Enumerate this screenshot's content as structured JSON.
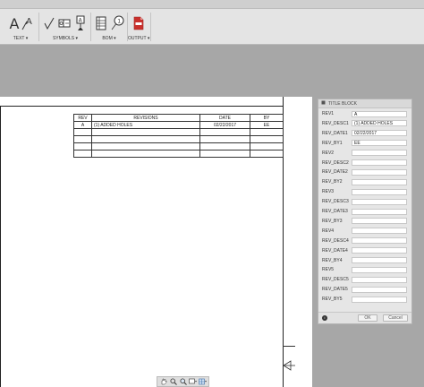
{
  "ribbon": {
    "groups": [
      {
        "label": "TEXT ▾"
      },
      {
        "label": "SYMBOLS ▾"
      },
      {
        "label": "BOM ▾"
      },
      {
        "label": "OUTPUT ▾"
      }
    ]
  },
  "revision_table": {
    "headers": [
      "REV",
      "REVISIONS",
      "DATE",
      "BY"
    ],
    "rows": [
      [
        "A",
        "(1) ADDED HOLES",
        "02/22/2017",
        "EE"
      ],
      [
        "",
        "",
        "",
        ""
      ],
      [
        "",
        "",
        "",
        ""
      ],
      [
        "",
        "",
        "",
        ""
      ],
      [
        "",
        "",
        "",
        ""
      ]
    ]
  },
  "panel": {
    "title": "TITLE BLOCK",
    "fields": [
      {
        "label": "REV1",
        "value": "A"
      },
      {
        "label": "REV_DESC1",
        "value": "(1) ADDED HOLES"
      },
      {
        "label": "REV_DATE1",
        "value": "02/22/2017"
      },
      {
        "label": "REV_BY1",
        "value": "EE"
      },
      {
        "label": "REV2",
        "value": ""
      },
      {
        "label": "REV_DESC2",
        "value": ""
      },
      {
        "label": "REV_DATE2",
        "value": ""
      },
      {
        "label": "REV_BY2",
        "value": ""
      },
      {
        "label": "REV3",
        "value": ""
      },
      {
        "label": "REV_DESC3",
        "value": ""
      },
      {
        "label": "REV_DATE3",
        "value": ""
      },
      {
        "label": "REV_BY3",
        "value": ""
      },
      {
        "label": "REV4",
        "value": ""
      },
      {
        "label": "REV_DESC4",
        "value": ""
      },
      {
        "label": "REV_DATE4",
        "value": ""
      },
      {
        "label": "REV_BY4",
        "value": ""
      },
      {
        "label": "REV5",
        "value": ""
      },
      {
        "label": "REV_DESC5",
        "value": ""
      },
      {
        "label": "REV_DATE5",
        "value": ""
      },
      {
        "label": "REV_BY5",
        "value": ""
      }
    ],
    "ok_label": "OK",
    "cancel_label": "Cancel",
    "info_glyph": "i"
  },
  "icons": {
    "text": "text-icon",
    "leader_text": "leader-text-icon",
    "surface_texture": "surface-texture-icon",
    "feature_control": "feature-control-frame-icon",
    "datum": "datum-identifier-icon",
    "table": "table-icon",
    "balloon": "balloon-icon",
    "pdf": "pdf-icon"
  },
  "colors": {
    "pdf_red": "#c9302c",
    "pdf_corner": "#e8a09e"
  }
}
